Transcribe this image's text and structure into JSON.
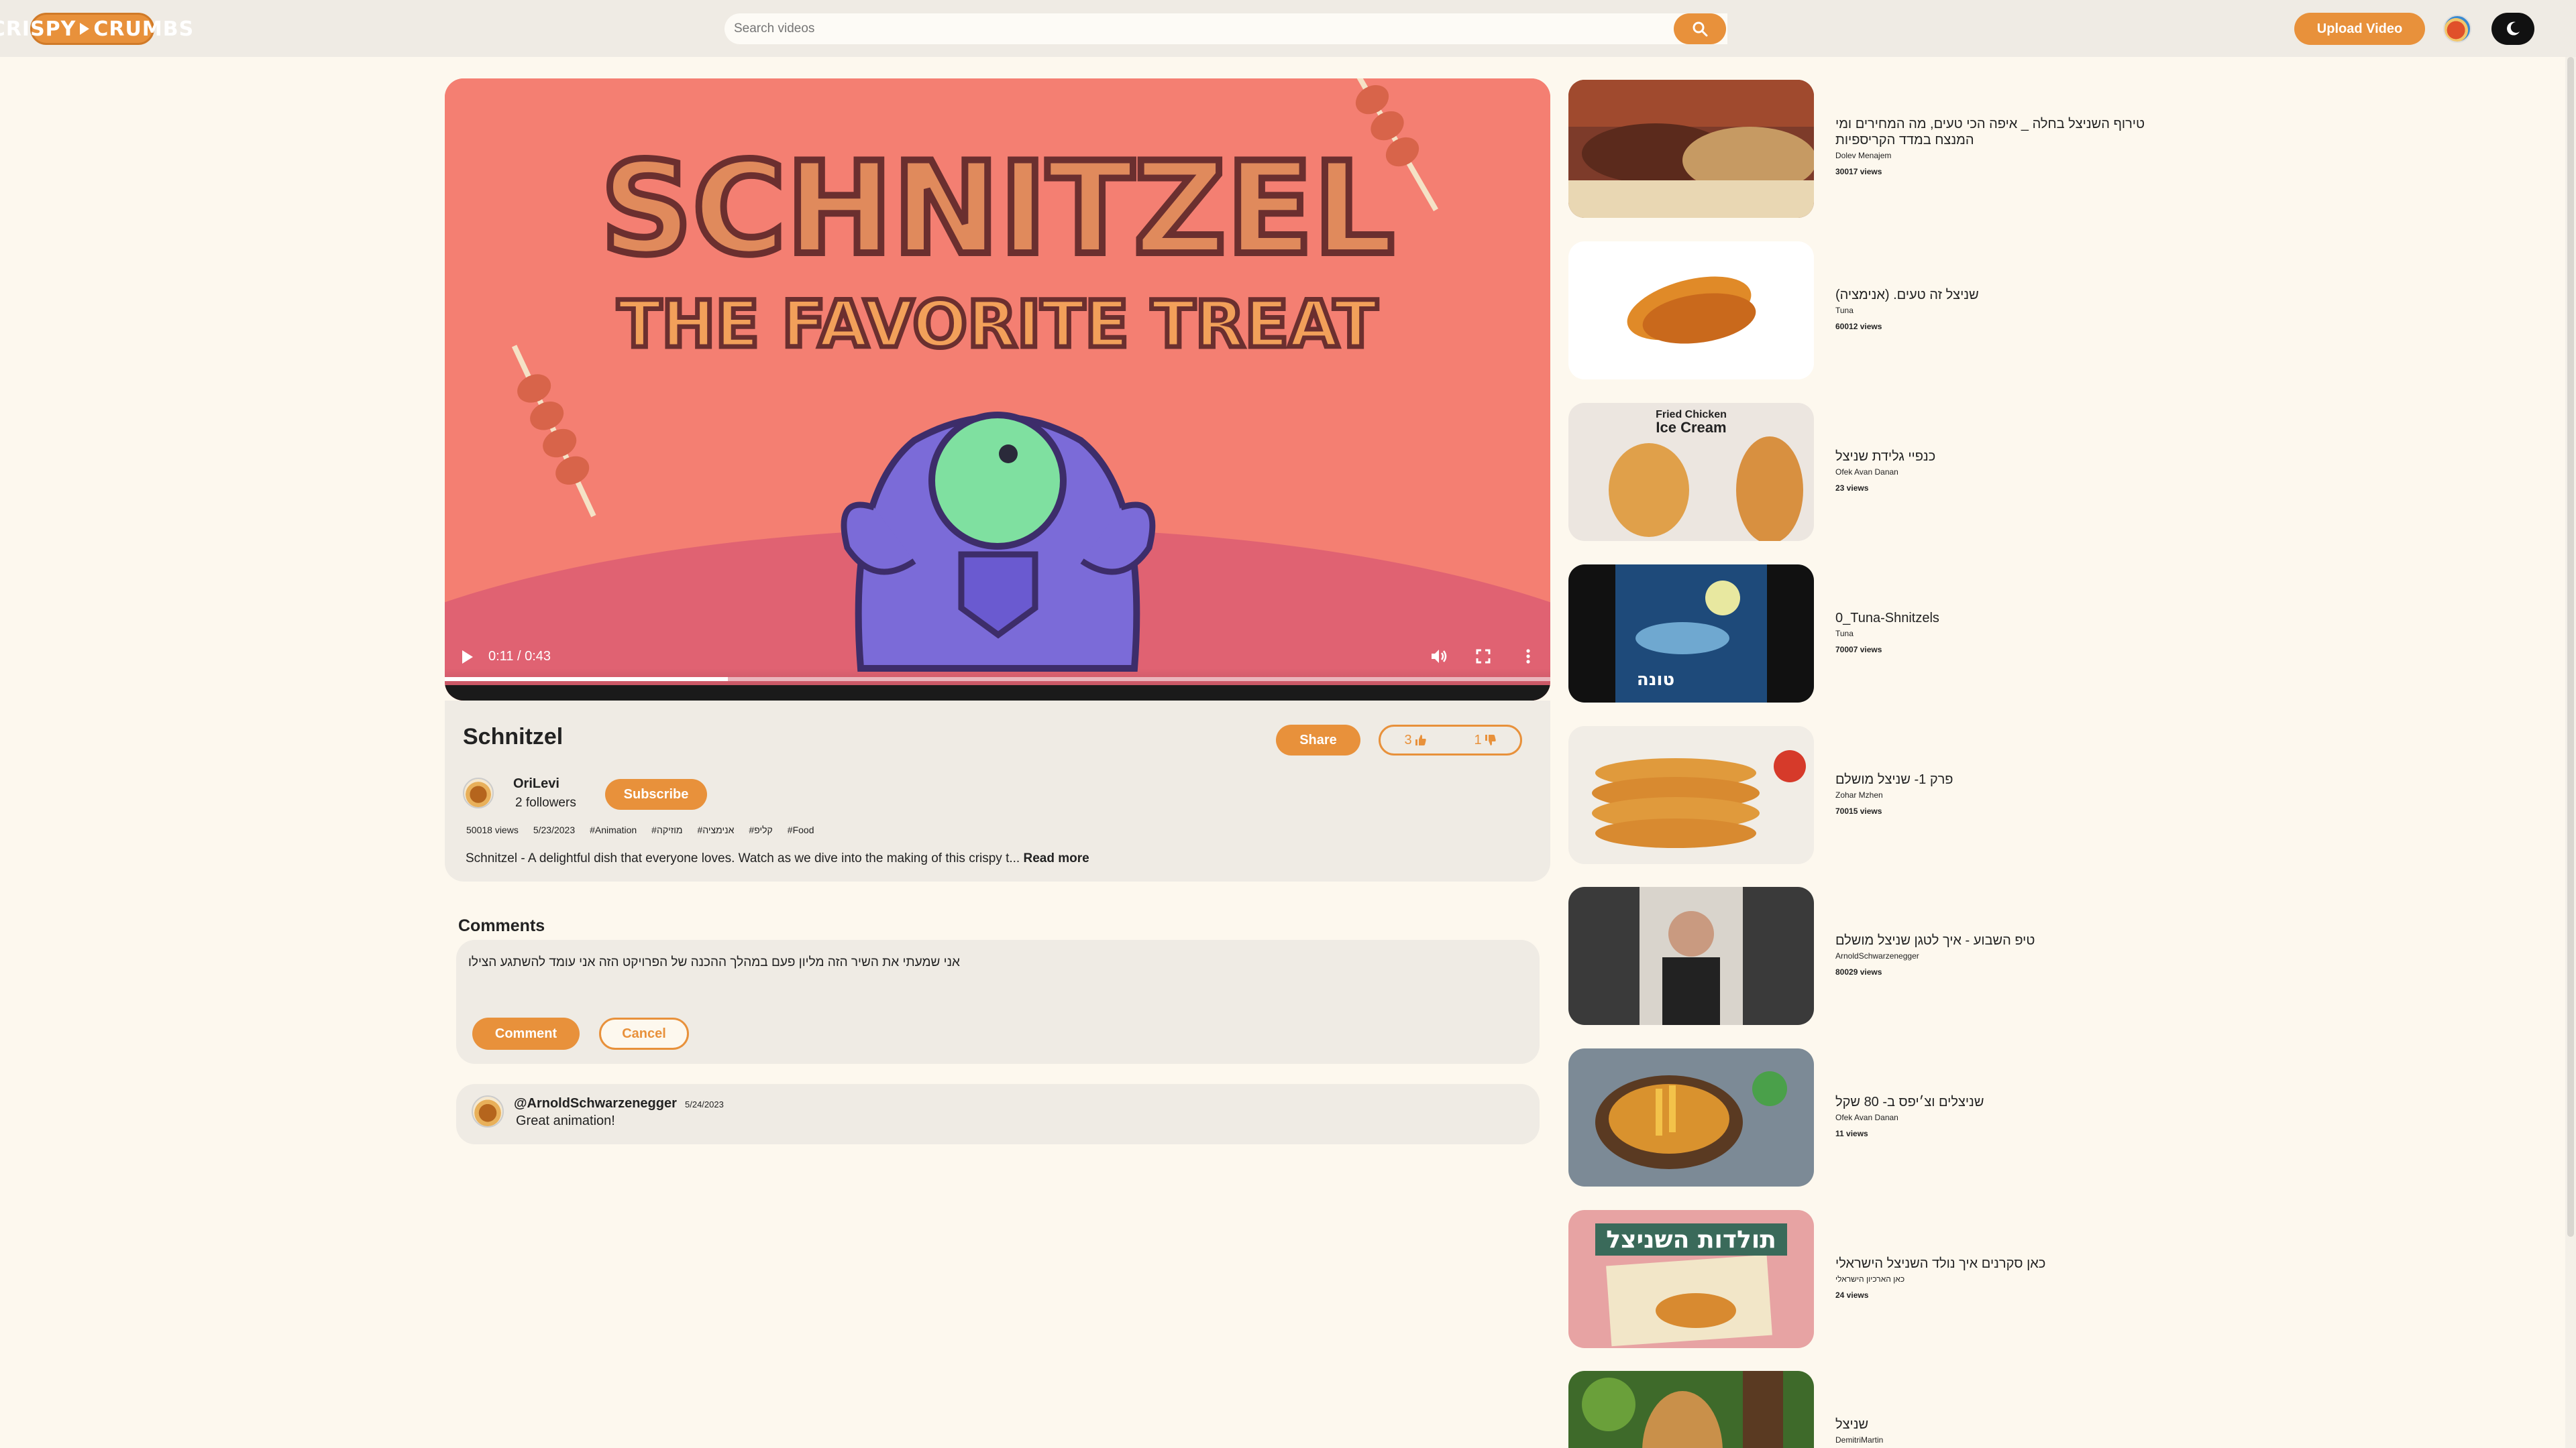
{
  "header": {
    "logo_text": "CRISPY ▶ CRUMBS",
    "logo_left": "CRISPY",
    "logo_right": "CRUMBS",
    "search_placeholder": "Search videos",
    "upload_label": "Upload Video",
    "icons": {
      "search": "search-icon",
      "theme": "moon-icon",
      "avatar": "user-avatar"
    }
  },
  "colors": {
    "accent": "#e8913b",
    "background": "#fdf8ee",
    "panel": "#efebe4"
  },
  "player": {
    "time": "0:11 / 0:43",
    "progress": 0.256,
    "thumbnail_title_line1": "SCHNITZEL",
    "thumbnail_title_line2": "THE FAVORITE TREAT"
  },
  "video": {
    "title": "Schnitzel",
    "share_label": "Share",
    "likes": "3",
    "dislikes": "1",
    "channel": "OriLevi",
    "followers": "2 followers",
    "subscribe_label": "Subscribe",
    "views": "50018 views",
    "date": "5/23/2023",
    "tags": [
      "#Animation",
      "#מוזיקה",
      "#אנימציה",
      "#קליפ",
      "#Food"
    ],
    "description": "Schnitzel - A delightful dish that everyone loves. Watch as we dive into the making of this crispy t...",
    "read_more": "Read more"
  },
  "comments": {
    "title": "Comments",
    "draft": "אני  שמעתי את השיר הזה מליון פעם במהלך ההכנה  של הפרויקט הזה אני עומד להשתגע  הצילו",
    "submit_label": "Comment",
    "cancel_label": "Cancel",
    "items": [
      {
        "author": "@ArnoldSchwarzenegger",
        "date": "5/24/2023",
        "text": "Great animation!"
      }
    ]
  },
  "recommendations": [
    {
      "title": "טירוף השניצל בחלה _ איפה הכי טעים, מה המחירים ומי המנצח במדד הקריספיות",
      "channel": "Dolev Menajem",
      "views": "30017 views"
    },
    {
      "title": "שניצל זה טעים. (אנימציה)",
      "channel": "Tuna",
      "views": "60012 views"
    },
    {
      "title": "כנפיי גלידת שניצל",
      "channel": "Ofek Avan Danan",
      "views": "23 views",
      "thumb_label_1": "Fried Chicken",
      "thumb_label_2": "Ice Cream"
    },
    {
      "title": "0_Tuna-Shnitzels",
      "channel": "Tuna",
      "views": "70007 views",
      "thumb_label_1": "טונה"
    },
    {
      "title": "פרק 1- שניצל מושלם",
      "channel": "Zohar Mzhen",
      "views": "70015 views"
    },
    {
      "title": "טיפ השבוע - איך לטגן שניצל מושלם",
      "channel": "ArnoldSchwarzenegger",
      "views": "80029 views"
    },
    {
      "title": "שניצלים וצ׳יפס ב- 80 שקל",
      "channel": "Ofek Avan Danan",
      "views": "11 views"
    },
    {
      "title": "כאן סקרנים איך נולד השניצל הישראלי",
      "channel": "כאן הארכיון הישראלי",
      "views": "24 views",
      "thumb_label_1": "תולדות השניצל"
    },
    {
      "title": "שניצל",
      "channel": "DemitriMartin",
      "views": ""
    }
  ]
}
